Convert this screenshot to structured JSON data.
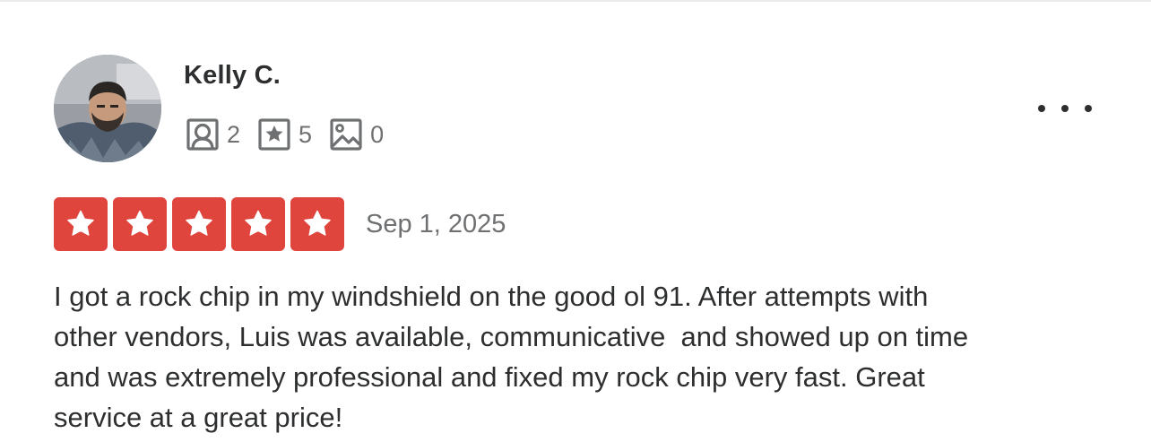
{
  "review": {
    "user": {
      "name": "Kelly C.",
      "friends_count": "2",
      "reviews_count": "5",
      "photos_count": "0"
    },
    "rating": 5,
    "rating_max": 5,
    "date": "Sep 1, 2025",
    "text": "I got a rock chip in my windshield on the good ol 91. After attempts with\nother vendors, Luis was available, communicative  and showed up on time\nand was extremely professional and fixed my rock chip very fast. Great\nservice at a great price!"
  },
  "icons": {
    "friends": "friends-icon",
    "reviews": "review-star-icon",
    "photos": "photo-icon",
    "more": "more-options-icon"
  },
  "colors": {
    "star_fill": "#e0453d",
    "text": "#2d2e2f",
    "muted": "#6e7072"
  }
}
